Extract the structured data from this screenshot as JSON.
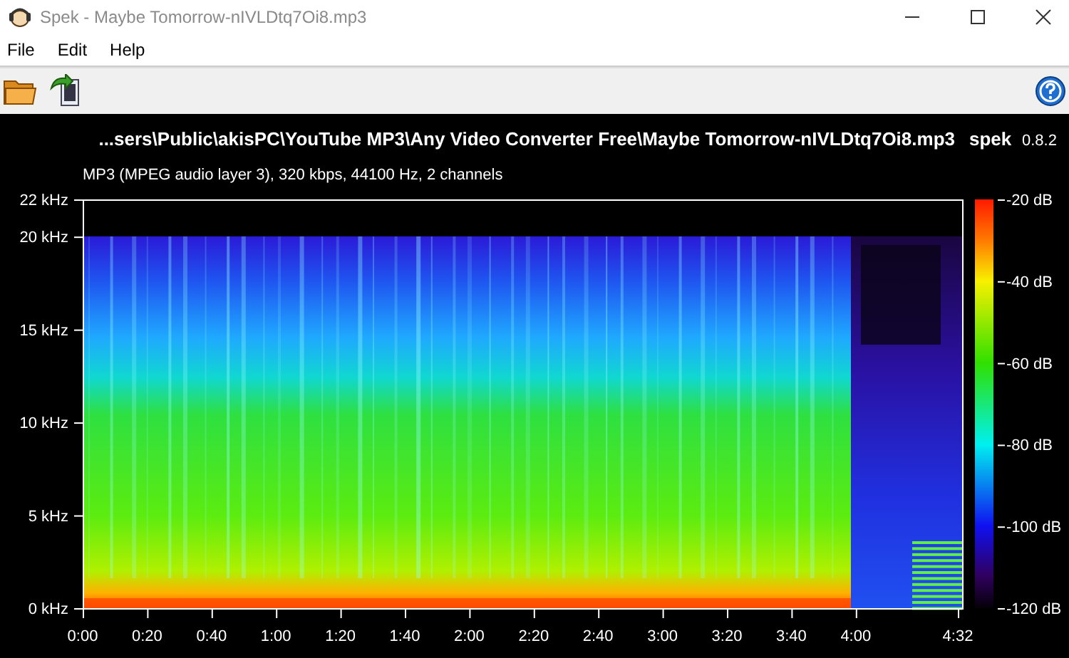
{
  "window": {
    "title": "Spek - Maybe Tomorrow-nIVLDtq7Oi8.mp3"
  },
  "menu": [
    "File",
    "Edit",
    "Help"
  ],
  "header": {
    "path": "...sers\\Public\\akisPC\\YouTube MP3\\Any Video Converter Free\\Maybe Tomorrow-nIVLDtq7Oi8.mp3",
    "app_name": "spek",
    "version": "0.8.2",
    "info": "MP3 (MPEG audio layer 3), 320 kbps, 44100 Hz, 2 channels"
  },
  "frequency_axis": [
    "22 kHz",
    "20 kHz",
    "15 kHz",
    "10 kHz",
    "5 kHz",
    "0 kHz"
  ],
  "time_axis": [
    "0:00",
    "0:20",
    "0:40",
    "1:00",
    "1:20",
    "1:40",
    "2:00",
    "2:20",
    "2:40",
    "3:00",
    "3:20",
    "3:40",
    "4:00",
    "4:32"
  ],
  "level_scale": [
    "-20 dB",
    "-40 dB",
    "-60 dB",
    "-80 dB",
    "-100 dB",
    "-120 dB"
  ]
}
